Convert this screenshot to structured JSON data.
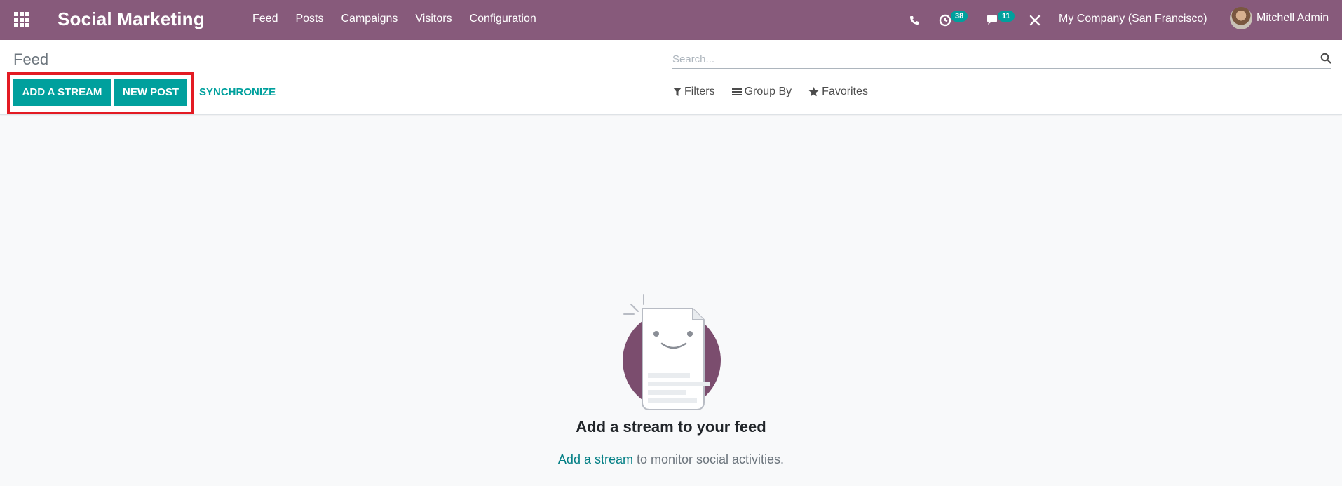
{
  "navbar": {
    "app_title": "Social Marketing",
    "menu": [
      "Feed",
      "Posts",
      "Campaigns",
      "Visitors",
      "Configuration"
    ],
    "activity_count": "38",
    "messages_count": "11",
    "company": "My Company (San Francisco)",
    "user_name": "Mitchell Admin"
  },
  "control": {
    "breadcrumb": "Feed",
    "add_stream_label": "ADD A STREAM",
    "new_post_label": "NEW POST",
    "synchronize_label": "SYNCHRONIZE",
    "search_placeholder": "Search...",
    "filters_label": "Filters",
    "group_by_label": "Group By",
    "favorites_label": "Favorites"
  },
  "empty_state": {
    "title": "Add a stream to your feed",
    "link_text": "Add a stream",
    "rest_text": " to monitor social activities."
  },
  "colors": {
    "brand": "#875a7b",
    "accent": "#00a09d",
    "highlight_box": "#e31b23"
  }
}
